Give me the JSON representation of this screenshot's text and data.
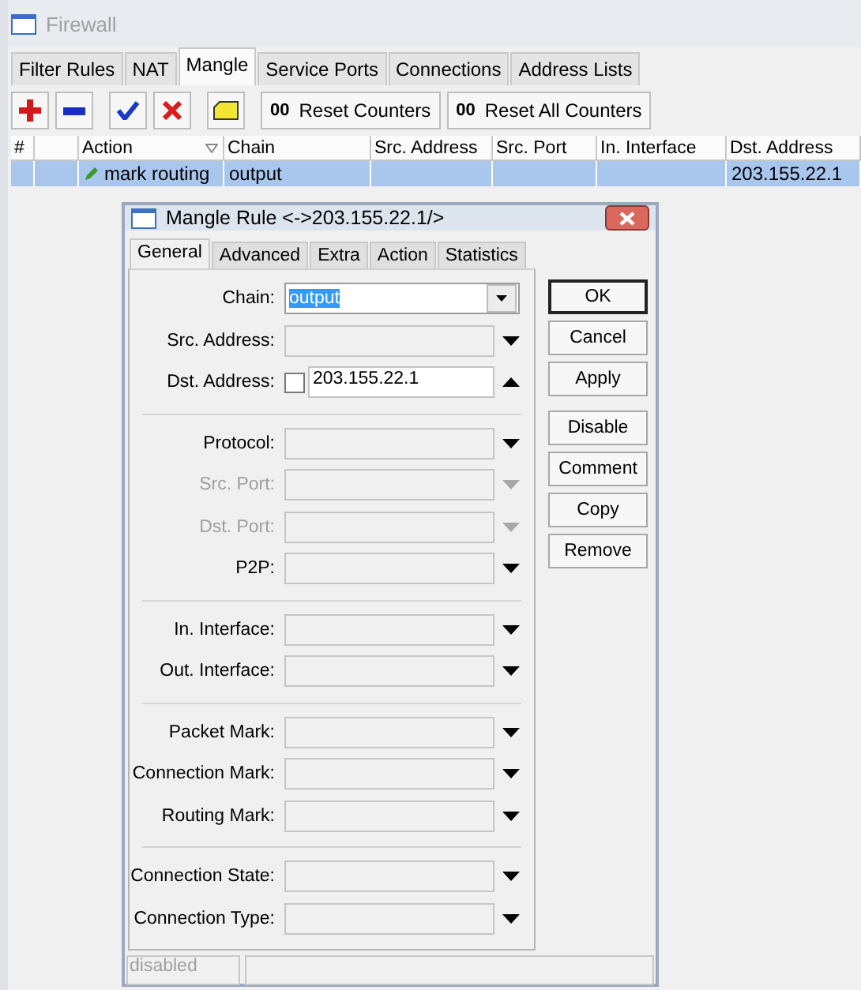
{
  "window": {
    "title": "Firewall"
  },
  "tabs": [
    {
      "label": "Filter Rules",
      "selected": false
    },
    {
      "label": "NAT",
      "selected": false
    },
    {
      "label": "Mangle",
      "selected": true
    },
    {
      "label": "Service Ports",
      "selected": false
    },
    {
      "label": "Connections",
      "selected": false
    },
    {
      "label": "Address Lists",
      "selected": false
    }
  ],
  "toolbar": [
    [
      {
        "kind": "add"
      },
      {
        "kind": "remove"
      }
    ],
    [
      {
        "kind": "enable"
      },
      {
        "kind": "disable"
      }
    ],
    [
      {
        "kind": "comment"
      }
    ],
    [
      {
        "kind": "text",
        "icon_text": "00",
        "label": "Reset Counters"
      },
      {
        "kind": "text",
        "icon_text": "00",
        "label": "Reset All Counters"
      }
    ]
  ],
  "table": {
    "columns": [
      {
        "label": "#",
        "sorted": false
      },
      {
        "label": "Action",
        "sorted": true
      },
      {
        "label": "Chain",
        "sorted": false
      },
      {
        "label": "Src. Address",
        "sorted": false
      },
      {
        "label": "Src. Port",
        "sorted": false
      },
      {
        "label": "In. Interface",
        "sorted": false
      },
      {
        "label": "Dst. Address",
        "sorted": false
      }
    ],
    "rows": [
      {
        "selected": true,
        "cells": [
          null,
          "mark routing",
          "output",
          null,
          null,
          null,
          "203.155.22.1"
        ]
      }
    ]
  },
  "dialog": {
    "title": "Mangle Rule <->203.155.22.1/>",
    "tabs": [
      {
        "label": "General",
        "selected": true
      },
      {
        "label": "Advanced",
        "selected": false
      },
      {
        "label": "Extra",
        "selected": false
      },
      {
        "label": "Action",
        "selected": false
      },
      {
        "label": "Statistics",
        "selected": false
      }
    ],
    "field_groups": [
      [
        {
          "kind": "combo",
          "label": "Chain:",
          "value": "output",
          "value_selected": true
        },
        {
          "kind": "dropdown",
          "label": "Src. Address:",
          "disabled": false,
          "expanded": false
        },
        {
          "kind": "address",
          "label": "Dst. Address:",
          "checked": false,
          "value": "203.155.22.1",
          "expanded": true
        }
      ],
      [
        {
          "kind": "dropdown",
          "label": "Protocol:",
          "disabled": false,
          "expanded": false
        },
        {
          "kind": "dropdown",
          "label": "Src. Port:",
          "disabled": true,
          "expanded": false
        },
        {
          "kind": "dropdown",
          "label": "Dst. Port:",
          "disabled": true,
          "expanded": false
        },
        {
          "kind": "dropdown",
          "label": "P2P:",
          "disabled": false,
          "expanded": false
        }
      ],
      [
        {
          "kind": "dropdown",
          "label": "In. Interface:",
          "disabled": false,
          "expanded": false
        },
        {
          "kind": "dropdown",
          "label": "Out. Interface:",
          "disabled": false,
          "expanded": false
        }
      ],
      [
        {
          "kind": "dropdown",
          "label": "Packet Mark:",
          "disabled": false,
          "expanded": false
        },
        {
          "kind": "dropdown",
          "label": "Connection Mark:",
          "disabled": false,
          "expanded": false
        },
        {
          "kind": "dropdown",
          "label": "Routing Mark:",
          "disabled": false,
          "expanded": false
        }
      ],
      [
        {
          "kind": "dropdown",
          "label": "Connection State:",
          "disabled": false,
          "expanded": false
        },
        {
          "kind": "dropdown",
          "label": "Connection Type:",
          "disabled": false,
          "expanded": false
        }
      ]
    ],
    "buttons": [
      [
        {
          "label": "OK",
          "default": true
        },
        {
          "label": "Cancel",
          "default": false
        },
        {
          "label": "Apply",
          "default": false
        }
      ],
      [
        {
          "label": "Disable",
          "default": false
        },
        {
          "label": "Comment",
          "default": false
        },
        {
          "label": "Copy",
          "default": false
        },
        {
          "label": "Remove",
          "default": false
        }
      ]
    ],
    "status": {
      "state": "disabled"
    }
  }
}
